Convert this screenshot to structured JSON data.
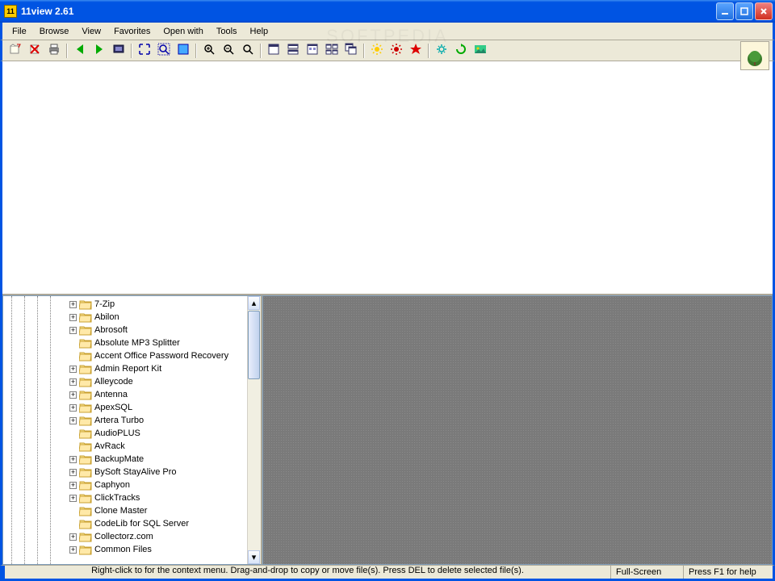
{
  "window": {
    "title": "11view 2.61"
  },
  "menu": [
    "File",
    "Browse",
    "View",
    "Favorites",
    "Open with",
    "Tools",
    "Help"
  ],
  "toolbar_groups": [
    [
      "open-file-icon",
      "delete-file-icon",
      "print-icon"
    ],
    [
      "back-icon",
      "forward-icon",
      "slideshow-icon"
    ],
    [
      "fit-icon",
      "zoom-fit-icon",
      "select-icon"
    ],
    [
      "zoom-in-icon",
      "zoom-out-icon",
      "zoom-icon"
    ],
    [
      "window-icon",
      "horizontal-split-icon",
      "thumbnail-icon",
      "tiles-icon",
      "cascade-icon"
    ],
    [
      "brightness-icon",
      "contrast-icon",
      "effects-icon"
    ],
    [
      "settings-icon",
      "refresh-icon",
      "wallpaper-icon"
    ]
  ],
  "tree": [
    {
      "label": "7-Zip",
      "expandable": true
    },
    {
      "label": "Abilon",
      "expandable": true
    },
    {
      "label": "Abrosoft",
      "expandable": true
    },
    {
      "label": "Absolute MP3 Splitter",
      "expandable": false
    },
    {
      "label": "Accent Office Password Recovery",
      "expandable": false
    },
    {
      "label": "Admin Report Kit",
      "expandable": true
    },
    {
      "label": "Alleycode",
      "expandable": true
    },
    {
      "label": "Antenna",
      "expandable": true
    },
    {
      "label": "ApexSQL",
      "expandable": true
    },
    {
      "label": "Artera Turbo",
      "expandable": true
    },
    {
      "label": "AudioPLUS",
      "expandable": false
    },
    {
      "label": "AvRack",
      "expandable": false
    },
    {
      "label": "BackupMate",
      "expandable": true
    },
    {
      "label": "BySoft StayAlive Pro",
      "expandable": true
    },
    {
      "label": "Caphyon",
      "expandable": true
    },
    {
      "label": "ClickTracks",
      "expandable": true
    },
    {
      "label": "Clone Master",
      "expandable": false
    },
    {
      "label": "CodeLib for SQL Server",
      "expandable": false
    },
    {
      "label": "Collectorz.com",
      "expandable": true
    },
    {
      "label": "Common Files",
      "expandable": true
    }
  ],
  "status": {
    "hint": "Right-click to for the context menu. Drag-and-drop to copy or move file(s).  Press DEL to delete selected file(s).",
    "mode": "Full-Screen",
    "help": "Press F1 for help"
  },
  "watermark": "SOFTPEDIA"
}
